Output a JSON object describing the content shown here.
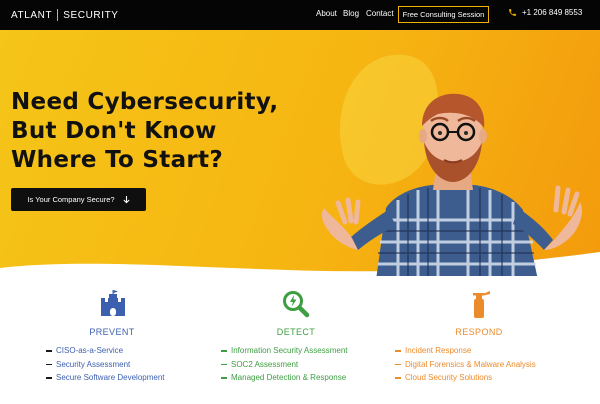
{
  "header": {
    "logo_left": "ATLANT",
    "logo_right": "SECURITY",
    "nav": [
      "About",
      "Blog",
      "Contact"
    ],
    "cta": "Free Consulting Session",
    "phone": "+1 206 849 8553"
  },
  "hero": {
    "title": "Need Cybersecurity,\nBut Don't Know\nWhere To Start?",
    "button": "Is Your Company Secure?"
  },
  "services": [
    {
      "title": "PREVENT",
      "icon": "castle-icon",
      "color": "#3d5fb0",
      "items": [
        "CISO-as-a-Service",
        "Security Assessment",
        "Secure Software Development"
      ]
    },
    {
      "title": "DETECT",
      "icon": "magnifier-bolt-icon",
      "color": "#3e9e42",
      "items": [
        "Information Security Assessment",
        "SOC2 Assessment",
        "Managed Detection & Response"
      ]
    },
    {
      "title": "RESPOND",
      "icon": "fire-extinguisher-icon",
      "color": "#ec8b2c",
      "items": [
        "Incident Response",
        "Digital Forensics & Malware Analysis",
        "Cloud Security Solutions"
      ]
    }
  ],
  "colors": {
    "header_bg": "#050505",
    "accent": "#f0b400",
    "hero_yellow": "#f5c518",
    "hero_orange": "#f39a0c"
  }
}
